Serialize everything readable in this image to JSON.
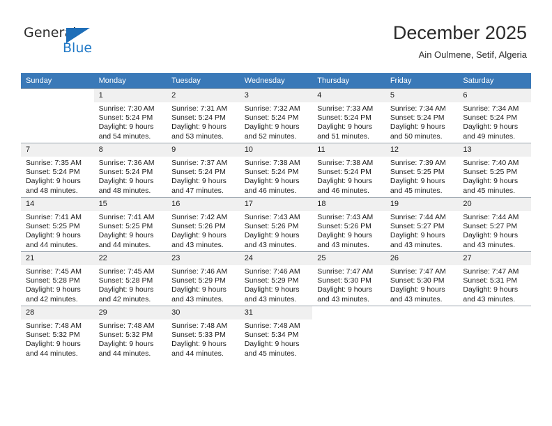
{
  "brand": {
    "name_part1": "General",
    "name_part2": "Blue",
    "logo_icon": "triangle-logo-icon",
    "accent_color": "#2079c7"
  },
  "header": {
    "month_title": "December 2025",
    "location": "Ain Oulmene, Setif, Algeria"
  },
  "calendar": {
    "header_background": "#3a79b8",
    "daynum_background": "#f0f0f0",
    "weekday_headers": [
      "Sunday",
      "Monday",
      "Tuesday",
      "Wednesday",
      "Thursday",
      "Friday",
      "Saturday"
    ],
    "weeks": [
      [
        {
          "day": "",
          "sunrise": "",
          "sunset": "",
          "daylight1": "",
          "daylight2": "",
          "blank": true
        },
        {
          "day": "1",
          "sunrise": "Sunrise: 7:30 AM",
          "sunset": "Sunset: 5:24 PM",
          "daylight1": "Daylight: 9 hours",
          "daylight2": "and 54 minutes."
        },
        {
          "day": "2",
          "sunrise": "Sunrise: 7:31 AM",
          "sunset": "Sunset: 5:24 PM",
          "daylight1": "Daylight: 9 hours",
          "daylight2": "and 53 minutes."
        },
        {
          "day": "3",
          "sunrise": "Sunrise: 7:32 AM",
          "sunset": "Sunset: 5:24 PM",
          "daylight1": "Daylight: 9 hours",
          "daylight2": "and 52 minutes."
        },
        {
          "day": "4",
          "sunrise": "Sunrise: 7:33 AM",
          "sunset": "Sunset: 5:24 PM",
          "daylight1": "Daylight: 9 hours",
          "daylight2": "and 51 minutes."
        },
        {
          "day": "5",
          "sunrise": "Sunrise: 7:34 AM",
          "sunset": "Sunset: 5:24 PM",
          "daylight1": "Daylight: 9 hours",
          "daylight2": "and 50 minutes."
        },
        {
          "day": "6",
          "sunrise": "Sunrise: 7:34 AM",
          "sunset": "Sunset: 5:24 PM",
          "daylight1": "Daylight: 9 hours",
          "daylight2": "and 49 minutes."
        }
      ],
      [
        {
          "day": "7",
          "sunrise": "Sunrise: 7:35 AM",
          "sunset": "Sunset: 5:24 PM",
          "daylight1": "Daylight: 9 hours",
          "daylight2": "and 48 minutes."
        },
        {
          "day": "8",
          "sunrise": "Sunrise: 7:36 AM",
          "sunset": "Sunset: 5:24 PM",
          "daylight1": "Daylight: 9 hours",
          "daylight2": "and 48 minutes."
        },
        {
          "day": "9",
          "sunrise": "Sunrise: 7:37 AM",
          "sunset": "Sunset: 5:24 PM",
          "daylight1": "Daylight: 9 hours",
          "daylight2": "and 47 minutes."
        },
        {
          "day": "10",
          "sunrise": "Sunrise: 7:38 AM",
          "sunset": "Sunset: 5:24 PM",
          "daylight1": "Daylight: 9 hours",
          "daylight2": "and 46 minutes."
        },
        {
          "day": "11",
          "sunrise": "Sunrise: 7:38 AM",
          "sunset": "Sunset: 5:24 PM",
          "daylight1": "Daylight: 9 hours",
          "daylight2": "and 46 minutes."
        },
        {
          "day": "12",
          "sunrise": "Sunrise: 7:39 AM",
          "sunset": "Sunset: 5:25 PM",
          "daylight1": "Daylight: 9 hours",
          "daylight2": "and 45 minutes."
        },
        {
          "day": "13",
          "sunrise": "Sunrise: 7:40 AM",
          "sunset": "Sunset: 5:25 PM",
          "daylight1": "Daylight: 9 hours",
          "daylight2": "and 45 minutes."
        }
      ],
      [
        {
          "day": "14",
          "sunrise": "Sunrise: 7:41 AM",
          "sunset": "Sunset: 5:25 PM",
          "daylight1": "Daylight: 9 hours",
          "daylight2": "and 44 minutes."
        },
        {
          "day": "15",
          "sunrise": "Sunrise: 7:41 AM",
          "sunset": "Sunset: 5:25 PM",
          "daylight1": "Daylight: 9 hours",
          "daylight2": "and 44 minutes."
        },
        {
          "day": "16",
          "sunrise": "Sunrise: 7:42 AM",
          "sunset": "Sunset: 5:26 PM",
          "daylight1": "Daylight: 9 hours",
          "daylight2": "and 43 minutes."
        },
        {
          "day": "17",
          "sunrise": "Sunrise: 7:43 AM",
          "sunset": "Sunset: 5:26 PM",
          "daylight1": "Daylight: 9 hours",
          "daylight2": "and 43 minutes."
        },
        {
          "day": "18",
          "sunrise": "Sunrise: 7:43 AM",
          "sunset": "Sunset: 5:26 PM",
          "daylight1": "Daylight: 9 hours",
          "daylight2": "and 43 minutes."
        },
        {
          "day": "19",
          "sunrise": "Sunrise: 7:44 AM",
          "sunset": "Sunset: 5:27 PM",
          "daylight1": "Daylight: 9 hours",
          "daylight2": "and 43 minutes."
        },
        {
          "day": "20",
          "sunrise": "Sunrise: 7:44 AM",
          "sunset": "Sunset: 5:27 PM",
          "daylight1": "Daylight: 9 hours",
          "daylight2": "and 43 minutes."
        }
      ],
      [
        {
          "day": "21",
          "sunrise": "Sunrise: 7:45 AM",
          "sunset": "Sunset: 5:28 PM",
          "daylight1": "Daylight: 9 hours",
          "daylight2": "and 42 minutes."
        },
        {
          "day": "22",
          "sunrise": "Sunrise: 7:45 AM",
          "sunset": "Sunset: 5:28 PM",
          "daylight1": "Daylight: 9 hours",
          "daylight2": "and 42 minutes."
        },
        {
          "day": "23",
          "sunrise": "Sunrise: 7:46 AM",
          "sunset": "Sunset: 5:29 PM",
          "daylight1": "Daylight: 9 hours",
          "daylight2": "and 43 minutes."
        },
        {
          "day": "24",
          "sunrise": "Sunrise: 7:46 AM",
          "sunset": "Sunset: 5:29 PM",
          "daylight1": "Daylight: 9 hours",
          "daylight2": "and 43 minutes."
        },
        {
          "day": "25",
          "sunrise": "Sunrise: 7:47 AM",
          "sunset": "Sunset: 5:30 PM",
          "daylight1": "Daylight: 9 hours",
          "daylight2": "and 43 minutes."
        },
        {
          "day": "26",
          "sunrise": "Sunrise: 7:47 AM",
          "sunset": "Sunset: 5:30 PM",
          "daylight1": "Daylight: 9 hours",
          "daylight2": "and 43 minutes."
        },
        {
          "day": "27",
          "sunrise": "Sunrise: 7:47 AM",
          "sunset": "Sunset: 5:31 PM",
          "daylight1": "Daylight: 9 hours",
          "daylight2": "and 43 minutes."
        }
      ],
      [
        {
          "day": "28",
          "sunrise": "Sunrise: 7:48 AM",
          "sunset": "Sunset: 5:32 PM",
          "daylight1": "Daylight: 9 hours",
          "daylight2": "and 44 minutes."
        },
        {
          "day": "29",
          "sunrise": "Sunrise: 7:48 AM",
          "sunset": "Sunset: 5:32 PM",
          "daylight1": "Daylight: 9 hours",
          "daylight2": "and 44 minutes."
        },
        {
          "day": "30",
          "sunrise": "Sunrise: 7:48 AM",
          "sunset": "Sunset: 5:33 PM",
          "daylight1": "Daylight: 9 hours",
          "daylight2": "and 44 minutes."
        },
        {
          "day": "31",
          "sunrise": "Sunrise: 7:48 AM",
          "sunset": "Sunset: 5:34 PM",
          "daylight1": "Daylight: 9 hours",
          "daylight2": "and 45 minutes."
        },
        {
          "day": "",
          "sunrise": "",
          "sunset": "",
          "daylight1": "",
          "daylight2": "",
          "blank": true
        },
        {
          "day": "",
          "sunrise": "",
          "sunset": "",
          "daylight1": "",
          "daylight2": "",
          "blank": true
        },
        {
          "day": "",
          "sunrise": "",
          "sunset": "",
          "daylight1": "",
          "daylight2": "",
          "blank": true
        }
      ]
    ]
  }
}
